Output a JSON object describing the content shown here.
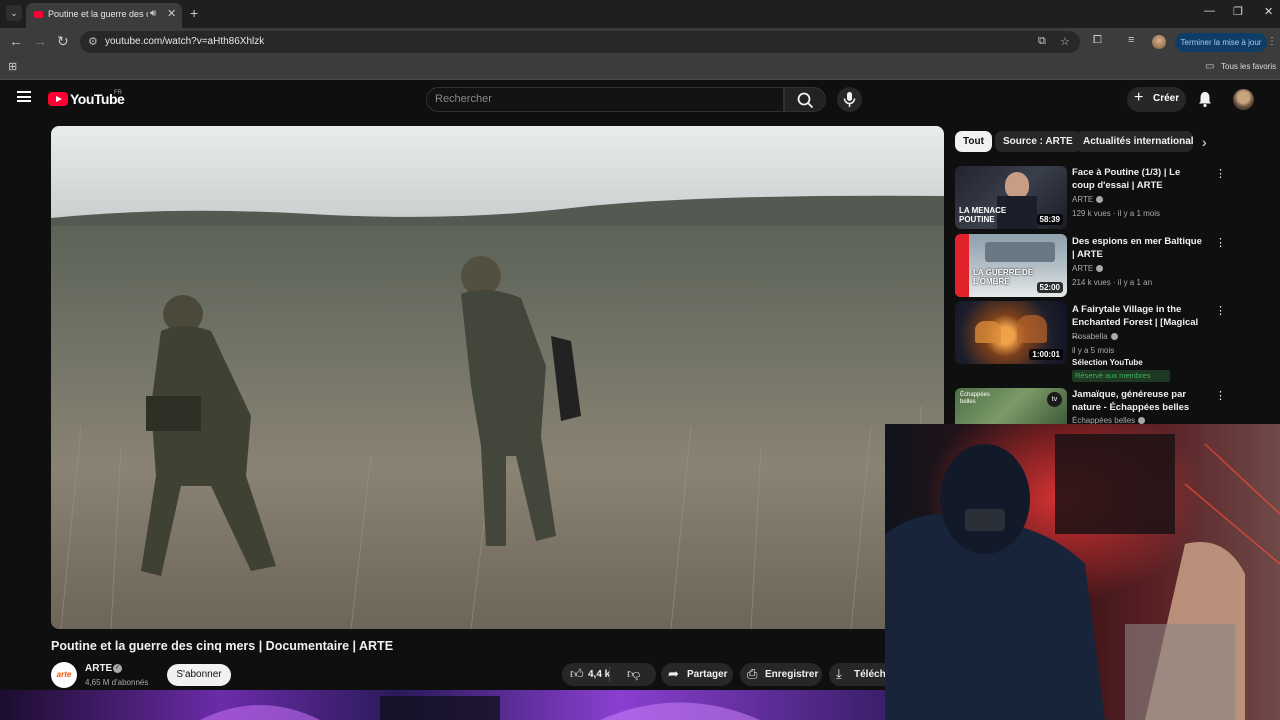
{
  "browser": {
    "tab_title": "Poutine et la guerre des cinq mers | Documentaire | ARTE",
    "url": "youtube.com/watch?v=aHth86Xhlzk",
    "update_button": "Terminer la mise à jour",
    "bookmarks_label": "Tous les favoris"
  },
  "youtube": {
    "wordmark": "YouTube",
    "country": "FR",
    "search_placeholder": "Rechercher",
    "create_label": "Créer"
  },
  "video": {
    "title": "Poutine et la guerre des cinq mers | Documentaire | ARTE",
    "channel": "ARTE",
    "channel_logo_text": "arte",
    "subscribers": "4,65 M d'abonnés",
    "subscribe_label": "S'abonner",
    "likes": "4,4 k",
    "share_label": "Partager",
    "save_label": "Enregistrer",
    "download_label": "Téléchar"
  },
  "chips": [
    "Tout",
    "Source : ARTE",
    "Actualités internationales"
  ],
  "related": [
    {
      "title": "Face à Poutine (1/3) | Le coup d'essai | ARTE",
      "channel": "ARTE",
      "meta": "129 k vues · il y a 1 mois",
      "duration": "58:39",
      "thumb_text": "LA MENACE POUTINE"
    },
    {
      "title": "Des espions en mer Baltique | ARTE",
      "channel": "ARTE",
      "meta": "214 k vues · il y a 1 an",
      "duration": "52:00",
      "thumb_text": "LA GUERRE DE L'OMBRE"
    },
    {
      "title": "A Fairytale Village in the Enchanted Forest | [Magical ...",
      "channel": "Rosabella",
      "meta": "il y a 5 mois",
      "duration": "1:00:01",
      "extra": "Sélection YouTube",
      "badge": "Réservé aux membres"
    },
    {
      "title": "Jamaïque, généreuse par nature - Échappées belles",
      "channel": "Échappées belles",
      "thumb_text": "Échappées belles"
    }
  ]
}
